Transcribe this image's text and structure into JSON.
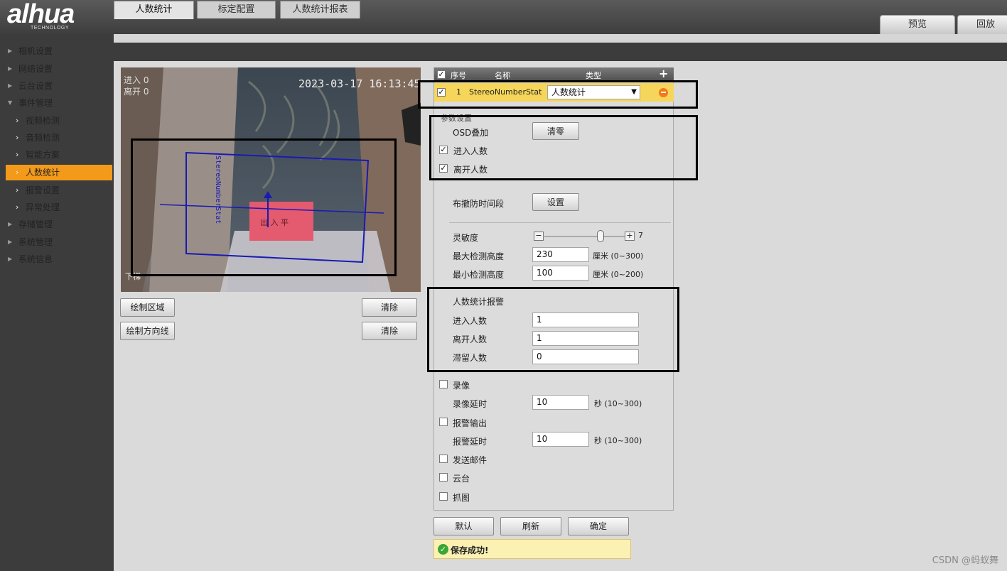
{
  "app": {
    "logo": "alhua",
    "logo_sub": "TECHNOLOGY"
  },
  "top_tabs": [
    "预览",
    "回放"
  ],
  "nav": {
    "items": [
      {
        "label": "相机设置",
        "expanded": false
      },
      {
        "label": "网络设置",
        "expanded": false
      },
      {
        "label": "云台设置",
        "expanded": false
      },
      {
        "label": "事件管理",
        "expanded": true
      },
      {
        "label": "视频检测",
        "sub": true
      },
      {
        "label": "音频检测",
        "sub": true
      },
      {
        "label": "智能方案",
        "sub": true
      },
      {
        "label": "人数统计",
        "sub": true,
        "active": true
      },
      {
        "label": "报警设置",
        "sub": true
      },
      {
        "label": "异常处理",
        "sub": true
      },
      {
        "label": "存储管理",
        "expanded": false
      },
      {
        "label": "系统管理",
        "expanded": false
      },
      {
        "label": "系统信息",
        "expanded": false
      }
    ]
  },
  "tabs": [
    "人数统计",
    "标定配置",
    "人数统计报表"
  ],
  "video": {
    "timestamp": "2023-03-17 16:13:45",
    "osd_in": "进入 0",
    "osd_out": "离开 0",
    "rule_label": "StereoNumberStat",
    "mat_text": "出 入 平",
    "corner_text": "下梯"
  },
  "video_buttons": {
    "draw_area": "绘制区域",
    "clear1": "清除",
    "draw_direction": "绘制方向线",
    "clear2": "清除"
  },
  "rule_table": {
    "headers": {
      "index": "序号",
      "name": "名称",
      "type": "类型"
    },
    "row": {
      "index": "1",
      "name": "StereoNumberStat",
      "type": "人数统计",
      "checked": true
    }
  },
  "params": {
    "section": "参数设置",
    "osd": "OSD叠加",
    "clear_btn": "清零",
    "enter": "进入人数",
    "leave": "离开人数",
    "schedule": "布撤防时间段",
    "setup_btn": "设置",
    "sensitivity": "灵敏度",
    "sensitivity_value": "7",
    "sensitivity_level": 0.7,
    "max_height_label": "最大检测高度",
    "max_height": "230",
    "max_height_unit": "厘米 (0~300)",
    "min_height_label": "最小检测高度",
    "min_height": "100",
    "min_height_unit": "厘米 (0~200)"
  },
  "alarm": {
    "title": "人数统计报警",
    "enter_label": "进入人数",
    "enter_value": "1",
    "leave_label": "离开人数",
    "leave_value": "1",
    "stay_label": "滞留人数",
    "stay_value": "0"
  },
  "linkage": {
    "record": "录像",
    "record_delay_label": "录像延时",
    "record_delay": "10",
    "record_delay_unit": "秒 (10~300)",
    "alarm_out": "报警输出",
    "alarm_delay_label": "报警延时",
    "alarm_delay": "10",
    "alarm_delay_unit": "秒 (10~300)",
    "email": "发送邮件",
    "ptz": "云台",
    "snapshot": "抓图"
  },
  "actions": {
    "default": "默认",
    "refresh": "刷新",
    "ok": "确定"
  },
  "status": {
    "message": "保存成功!",
    "color": "#3aa635"
  },
  "watermark": "CSDN @蚂蚁舞"
}
